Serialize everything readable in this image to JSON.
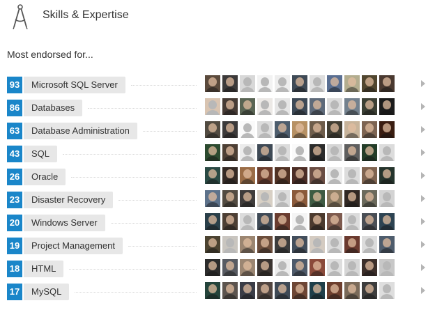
{
  "section": {
    "title": "Skills & Expertise",
    "icon": "compass-icon",
    "subtitle": "Most endorsed for..."
  },
  "colors": {
    "badge": "#1a86c9",
    "pill": "#e7e7e7",
    "text": "#333333",
    "arrow": "#b5b5b5"
  },
  "skills": [
    {
      "count": "93",
      "name": "Microsoft SQL Server",
      "avatars": [
        "#5b4a3c",
        "#3c3a3a",
        "#d8d8d8",
        "#f2f2f2",
        "#ededed",
        "#3f4a56",
        "#dedede",
        "#5a6f92",
        "#b3ad8f",
        "#51462f",
        "#4a3930"
      ]
    },
    {
      "count": "86",
      "name": "Databases",
      "avatars": [
        "#d9c4b1",
        "#463b35",
        "#596453",
        "#ece9e6",
        "#e6e6e6",
        "#3d4956",
        "#5e6a7a",
        "#dcdcdc",
        "#73818e",
        "#3b3f34",
        "#1c1c1c"
      ]
    },
    {
      "count": "63",
      "name": "Database Administration",
      "avatars": [
        "#524b41",
        "#3c3a3a",
        "#fafafa",
        "#dcdcdc",
        "#4d5d6d",
        "#b79164",
        "#6e5d4b",
        "#423e33",
        "#c7b39a",
        "#7d6452",
        "#3a1d11"
      ]
    },
    {
      "count": "43",
      "name": "SQL",
      "avatars": [
        "#2c4a2f",
        "#4d3f34",
        "#ececec",
        "#3f4a56",
        "#dcdcdc",
        "#fafafa",
        "#2b2b2b",
        "#d6d6d6",
        "#5f5f5f",
        "#233d28",
        "#dcdcdc"
      ]
    },
    {
      "count": "26",
      "name": "Oracle",
      "avatars": [
        "#2a4a44",
        "#352a25",
        "#9b6d47",
        "#6d3f2e",
        "#513224",
        "#4c2d26",
        "#6a4d43",
        "#ececec",
        "#dcdcdc",
        "#7f6450",
        "#25342c"
      ]
    },
    {
      "count": "23",
      "name": "Disaster Recovery",
      "avatars": [
        "#5d728b",
        "#524b41",
        "#3f3c3b",
        "#d8d0c5",
        "#dcdcdc",
        "#8b5a3a",
        "#3e5b43",
        "#8c7b62",
        "#312823",
        "#6b6a5c",
        "#d3d3d3"
      ]
    },
    {
      "count": "20",
      "name": "Windows Server",
      "avatars": [
        "#2a3f49",
        "#4d3f34",
        "#dcdcdc",
        "#3f4a56",
        "#6a3c2f",
        "#f5f5f5",
        "#4c3a2e",
        "#7d5a4e",
        "#dcdcdc",
        "#494e55",
        "#2d4352"
      ]
    },
    {
      "count": "19",
      "name": "Project Management",
      "avatars": [
        "#4c4331",
        "#c9c5bf",
        "#9c8671",
        "#6c4e3c",
        "#3c3c3c",
        "#424e5c",
        "#d4cbc1",
        "#dcdcdc",
        "#6b3a2f",
        "#dcdcdc",
        "#4f5d6d"
      ]
    },
    {
      "count": "18",
      "name": "HTML",
      "avatars": [
        "#2c2c2c",
        "#585b62",
        "#9b8672",
        "#3b3431",
        "#ececec",
        "#4e5a6a",
        "#8a4a3a",
        "#dedede",
        "#d6d6d6",
        "#3c2f2a",
        "#c8c8c8"
      ]
    },
    {
      "count": "17",
      "name": "MySQL",
      "avatars": [
        "#24443b",
        "#5c544e",
        "#3b3d47",
        "#514540",
        "#3f4a56",
        "#6d4635",
        "#1f3f4a",
        "#6d3f2e",
        "#7a6a59",
        "#3d3d3d",
        "#dedede"
      ]
    }
  ]
}
